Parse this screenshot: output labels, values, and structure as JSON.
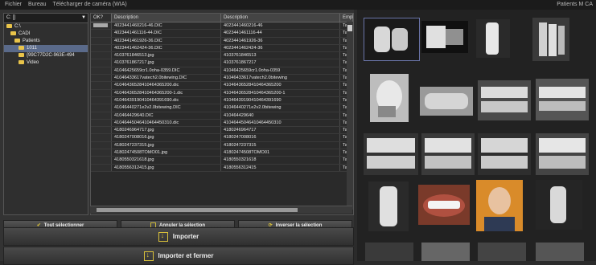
{
  "menu": {
    "items": [
      "Fichier",
      "Bureau",
      "Télécharger de caméra (WIA)"
    ],
    "right_text": "Patients M CA"
  },
  "tree": {
    "drive": "C: []",
    "items": [
      {
        "label": "C:\\",
        "indent": 0,
        "selected": false
      },
      {
        "label": "CADI",
        "indent": 1,
        "selected": false
      },
      {
        "label": "Patients",
        "indent": 2,
        "selected": false
      },
      {
        "label": "1011",
        "indent": 3,
        "selected": true
      },
      {
        "label": "{99C77D2C-963E-494",
        "indent": 3,
        "selected": false
      },
      {
        "label": "Video",
        "indent": 3,
        "selected": false
      }
    ]
  },
  "grid": {
    "headers": [
      "OK?",
      "Description",
      "Description",
      "Empl"
    ],
    "rows": [
      [
        "4023441460216-46.DIC",
        "4023441460216-46",
        "Tanvs"
      ],
      [
        "4023441461116-44.DIC",
        "4023441461116-44",
        "Tanvs"
      ],
      [
        "4023441461926-36.DIC",
        "4023441461926-36",
        "Tanvs"
      ],
      [
        "4023441462424-36.DIC",
        "4023441462424-36",
        "Tanvs"
      ],
      [
        "4103761846513.jpg",
        "4103761846513",
        "Tanvs"
      ],
      [
        "4103761867217.jpg",
        "4103761867217",
        "Tanvs"
      ],
      [
        "41046425659cr1.0oha-0359.DIC",
        "41046425659cr1.0oha-0359",
        "Tanvs"
      ],
      [
        "41046433617vatech2.0bitewing.DIC",
        "41046433617vatech2.0bitewing",
        "Tanvs"
      ],
      [
        "41046436528410464365200.dic",
        "41046436528410464365200",
        "Tanvs"
      ],
      [
        "41046436528410464365200-1.dic",
        "41046436528410464365200-1",
        "Tanvs"
      ],
      [
        "41046439190410464391690.dic",
        "41046439190410464391690",
        "Tanvs"
      ],
      [
        "41046440271e2v2.0bitewing.DIC",
        "41046440271e2v2.0bitewing",
        "Tanvs"
      ],
      [
        "410464429640.DIC",
        "410464429640",
        "Tanvs"
      ],
      [
        "41046445046410464450310.dic",
        "41046445046410464450310",
        "Tanvs"
      ],
      [
        "4180246964717.jpg",
        "4180246964717",
        "Tanvs"
      ],
      [
        "4180247008016.jpg",
        "4180247008016",
        "Tanvs"
      ],
      [
        "4180247237315.jpg",
        "4180247237315",
        "Tanvs"
      ],
      [
        "41802474508TOMO01.jpg",
        "41802474508TOMO01",
        "Tanvs"
      ],
      [
        "4180550321618.jpg",
        "4180550321618",
        "Tanvs"
      ],
      [
        "4180556312415.jpg",
        "4180556312415",
        "Tanvs"
      ]
    ]
  },
  "buttons": {
    "select_all": "Tout sélectionner",
    "cancel_selection": "Annuler la sélection",
    "invert_selection": "Inverser la sélection",
    "import": "Importer",
    "import_close": "Importer et fermer"
  },
  "colors": {
    "folder": "#e9c44a",
    "accent": "#d9c13a",
    "selection": "#5a6a8a"
  }
}
